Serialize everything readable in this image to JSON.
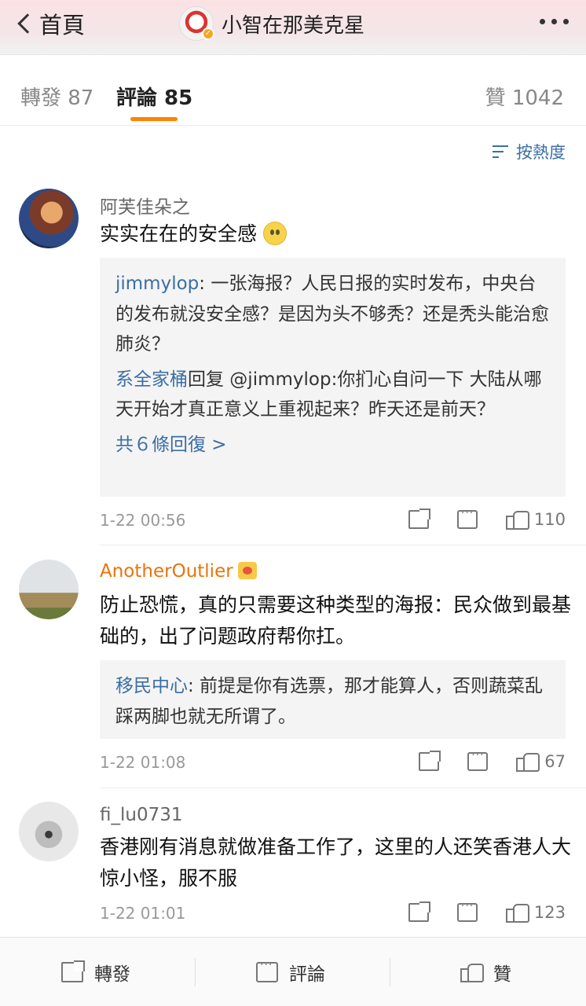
{
  "header": {
    "back_label": "首頁",
    "title": "小智在那美克星",
    "avatar_icon": "lion-dance-avatar-icon",
    "more_icon": "more-dots-icon"
  },
  "tabs": {
    "repost_label": "轉發 87",
    "comment_label": "評論 85",
    "like_label": "贊 1042",
    "active_color": "#ff8200"
  },
  "sort": {
    "label": "按熱度"
  },
  "comments": [
    {
      "user": "阿芙佳朵之",
      "text": "实实在在的安全感",
      "emoji": "rolling-eyes-emoji",
      "replies": [
        {
          "user": "jimmylop",
          "text": ": 一张海报？人民日报的实时发布，中央台的发布就没安全感？是因为头不够秃？还是秃头能治愈肺炎？"
        },
        {
          "user": "系全家桶",
          "text": "回复 @jimmylop:你扪心自问一下 大陆从哪天开始才真正意义上重视起来？昨天还是前天？"
        }
      ],
      "replies_more": "共６條回復 >",
      "time": "1-22 00:56",
      "likes": "110"
    },
    {
      "user": "AnotherOutlier",
      "text": "防止恐慌，真的只需要这种类型的海报：民众做到最基础的，出了问题政府帮你扛。",
      "replies": [
        {
          "user": "移民中心",
          "text": ": 前提是你有选票，那才能算人，否则蔬菜乱踩两脚也就无所谓了。"
        }
      ],
      "time": "1-22 01:08",
      "likes": "67"
    },
    {
      "user": "fi_lu0731",
      "text": "香港刚有消息就做准备工作了，这里的人还笑香港人大惊小怪，服不服",
      "time": "1-22 01:01",
      "likes": "123"
    }
  ],
  "bottom_bar": {
    "repost": "轉發",
    "comment": "評論",
    "like": "贊"
  }
}
